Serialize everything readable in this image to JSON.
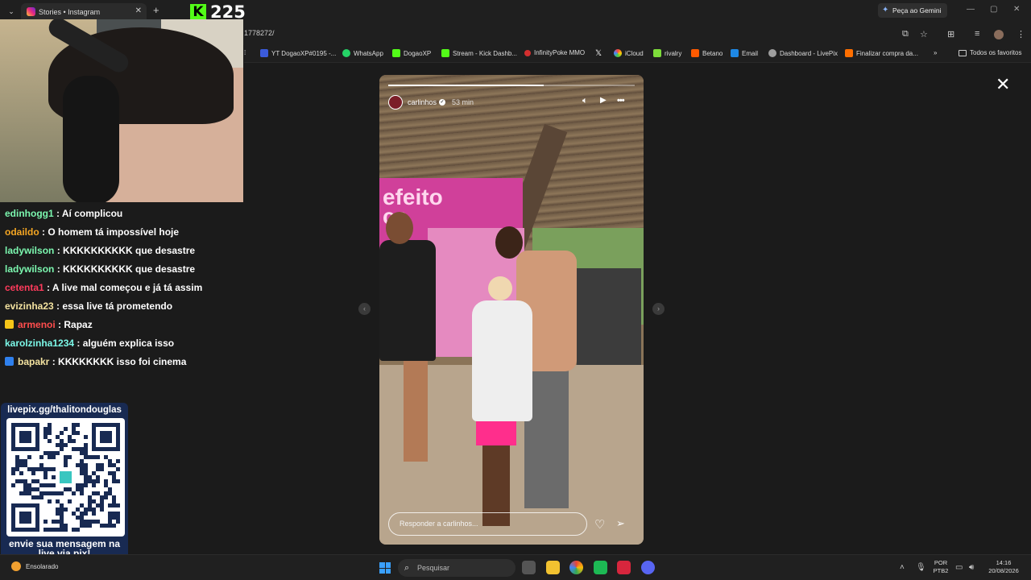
{
  "browser": {
    "tab_title": "Stories • Instagram",
    "tab_close": "✕",
    "new_tab": "+",
    "tab_menu": "⌄",
    "gemini_label": "Peça ao Gemini",
    "url": "1778272/",
    "window_controls": [
      "—",
      "▢",
      "✕"
    ]
  },
  "kick_overlay": {
    "logo": "K",
    "count": "225"
  },
  "bookmarks": {
    "items": [
      {
        "label": "YT DogaoXP#0195 -...",
        "color": "#3b5bdb"
      },
      {
        "label": "WhatsApp",
        "color": "#25d366"
      },
      {
        "label": "DogaoXP",
        "color": "#53fc18"
      },
      {
        "label": "Stream - Kick Dashb...",
        "color": "#53fc18"
      },
      {
        "label": "InfinityPoke MMO",
        "color": "#d32f2f"
      },
      {
        "label": "",
        "color": "#000000"
      },
      {
        "label": "iCloud",
        "color": "#cccccc"
      },
      {
        "label": "rivalry",
        "color": "#7ddc3a"
      },
      {
        "label": "Betano",
        "color": "#ff5a00"
      },
      {
        "label": "Email",
        "color": "#1e88e5"
      },
      {
        "label": "Dashboard - LivePix",
        "color": "#9e9e9e"
      },
      {
        "label": "Finalizar compra da...",
        "color": "#ff6f00"
      }
    ],
    "more": "»",
    "all_favorites": "Todos os favoritos"
  },
  "story": {
    "username": "carlinhos",
    "time_ago": "53 min",
    "progress": 0.63,
    "reply_placeholder": "Responder a carlinhos...",
    "close": "✕",
    "prev": "‹",
    "next": "›",
    "scene_sign": "efeito\nca",
    "icons": {
      "mute": "mute-icon",
      "play": "play-icon",
      "more": "more-icon",
      "like": "heart-icon",
      "share": "send-icon"
    }
  },
  "chat": {
    "messages": [
      {
        "user": "edinhogg1",
        "text": " : Aí complicou",
        "color": "#7cf8b0",
        "badge": null
      },
      {
        "user": "odaildo",
        "text": " : O homem tá impossível hoje",
        "color": "#f5a623",
        "badge": null
      },
      {
        "user": "ladywilson",
        "text": " : KKKKKKKKKK que desastre",
        "color": "#7cf8b0",
        "badge": null
      },
      {
        "user": "ladywilson",
        "text": " : KKKKKKKKKK que desastre",
        "color": "#7cf8b0",
        "badge": null
      },
      {
        "user": "cetenta1",
        "text": " : A live mal começou e já tá assim",
        "color": "#ff3b5c",
        "badge": null
      },
      {
        "user": "evizinha23",
        "text": " : essa live tá prometendo",
        "color": "#f4e3a0",
        "badge": null
      },
      {
        "user": "armenoi",
        "text": " : Rapaz",
        "color": "#ff4d4d",
        "badge": "#f5c518"
      },
      {
        "user": "karolzinha1234",
        "text": " : alguém explica isso",
        "color": "#7cf8e8",
        "badge": null
      },
      {
        "user": "bapakr",
        "text": " : KKKKKKKK isso foi cinema",
        "color": "#f4e3a0",
        "badge": "#2f80ed"
      }
    ]
  },
  "livepix": {
    "title": "livepix.gg/thalitondouglas",
    "footer": "envie sua mensagem na live via pix!"
  },
  "taskbar": {
    "weather": "Ensolarado",
    "search_placeholder": "Pesquisar",
    "lang_line1": "POR",
    "lang_line2": "PTB2",
    "time": "14:16",
    "date": "20/08/2026"
  }
}
